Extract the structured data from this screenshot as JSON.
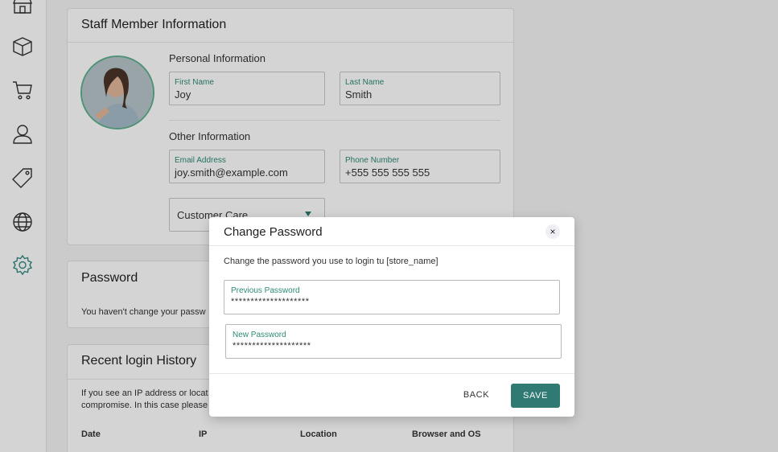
{
  "sidebar": {
    "icons": [
      {
        "name": "store-icon"
      },
      {
        "name": "package-icon"
      },
      {
        "name": "cart-icon"
      },
      {
        "name": "user-icon"
      },
      {
        "name": "tag-icon"
      },
      {
        "name": "globe-icon"
      },
      {
        "name": "settings-icon",
        "active": true
      }
    ],
    "active_color": "#2f8a80"
  },
  "staff_card": {
    "title": "Staff Member Information",
    "personal_label": "Personal Information",
    "first_name": {
      "label": "First Name",
      "value": "Joy"
    },
    "last_name": {
      "label": "Last Name",
      "value": "Smith"
    },
    "other_label": "Other Information",
    "email": {
      "label": "Email Address",
      "value": "joy.smith@example.com"
    },
    "phone": {
      "label": "Phone Number",
      "value": "+555 555 555 555"
    },
    "department": {
      "value": "Customer Care"
    }
  },
  "password_card": {
    "title": "Password",
    "text": "You haven't change your passw"
  },
  "history_card": {
    "title": "Recent login History",
    "text_line1": "If you see an IP address or locat",
    "text_line2": "compromise. In this case please",
    "columns": [
      "Date",
      "IP",
      "Location",
      "Browser and OS"
    ]
  },
  "modal": {
    "title": "Change Password",
    "description": "Change the password you use to login tu [store_name]",
    "previous": {
      "label": "Previous Password",
      "value": "********************"
    },
    "new": {
      "label": "New Password",
      "value": "********************"
    },
    "back_label": "BACK",
    "save_label": "SAVE",
    "close_glyph": "×",
    "accent": "#2f7a72"
  }
}
